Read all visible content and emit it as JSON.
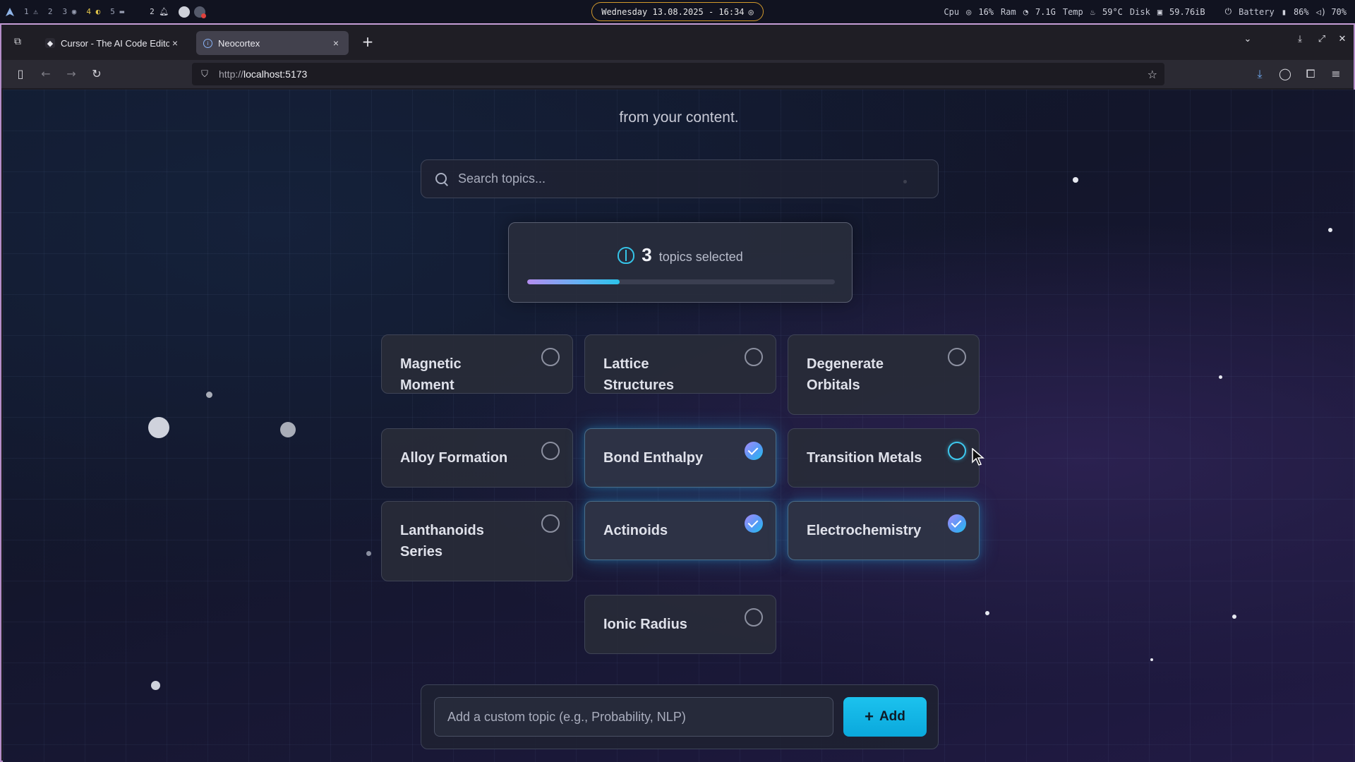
{
  "system_bar": {
    "workspaces": [
      "1",
      "2",
      "3",
      "4",
      "5"
    ],
    "notify_count": "2",
    "clock": "Wednesday 13.08.2025 - 16:34",
    "cpu_label": "Cpu",
    "cpu_value": "16%",
    "ram_label": "Ram",
    "ram_value": "7.1G",
    "temp_label": "Temp",
    "temp_value": "59°C",
    "disk_label": "Disk",
    "disk_value": "59.76iB",
    "battery_label": "Battery",
    "battery_value": "86%",
    "volume_value": "70%"
  },
  "browser": {
    "tabs": [
      {
        "title": "Cursor - The AI Code Editor",
        "active": false
      },
      {
        "title": "Neocortex",
        "active": true
      }
    ],
    "url_prefix": "http://",
    "url_host": "localhost:5173"
  },
  "page": {
    "subtitle": "from your content.",
    "search_placeholder": "Search topics...",
    "counter": {
      "count": "3",
      "label": "topics selected",
      "progress_fraction": 0.3
    },
    "topics": [
      {
        "label": "Magnetic Moment",
        "selected": false
      },
      {
        "label": "Lattice Structures",
        "selected": false
      },
      {
        "label": "Degenerate Orbitals",
        "selected": false
      },
      {
        "label": "Alloy Formation",
        "selected": false
      },
      {
        "label": "Bond Enthalpy",
        "selected": true
      },
      {
        "label": "Transition Metals",
        "selected": false
      },
      {
        "label": "Lanthanoids Series",
        "selected": false
      },
      {
        "label": "Actinoids",
        "selected": true
      },
      {
        "label": "Electrochemistry",
        "selected": true
      },
      {
        "label": "Ionic Radius",
        "selected": false
      }
    ],
    "custom_topic_placeholder": "Add a custom topic (e.g., Probability, NLP)",
    "add_button_label": "Add"
  },
  "colors": {
    "accent": "#1cc2ee",
    "frame": "#b58ec9"
  }
}
